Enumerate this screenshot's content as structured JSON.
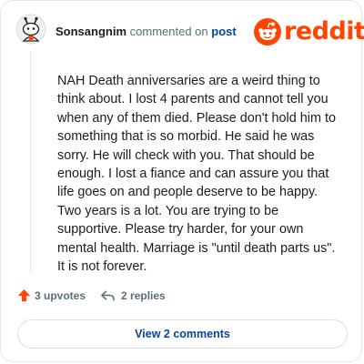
{
  "comment": {
    "username": "Sonsangnim",
    "action_text": "commented on",
    "post_link": "post",
    "body": "NAH Death anniversaries are a weird thing to think about. I lost 4 parents and cannot tell you when any of them died. Please don't hold him to something that is so morbid. He said he was sorry. He will check with you. That should be enough. I lost a fiance and can assure you that life goes on and people deserve to be happy. Two years is a lot. You are trying to be supportive. Please try harder, for your own mental health. Marriage is \"until death parts us\". It is not forever."
  },
  "brand": {
    "logo_text": "reddit",
    "color": "#ff4500"
  },
  "actions": {
    "upvotes_label": "3 upvotes",
    "replies_label": "2 replies",
    "upvote_icon": "upvote-arrow-icon",
    "reply_icon": "reply-icon",
    "upvote_color": "#ff4500"
  },
  "footer": {
    "view_comments_label": "View 2 comments",
    "link_color": "#0a449b"
  }
}
